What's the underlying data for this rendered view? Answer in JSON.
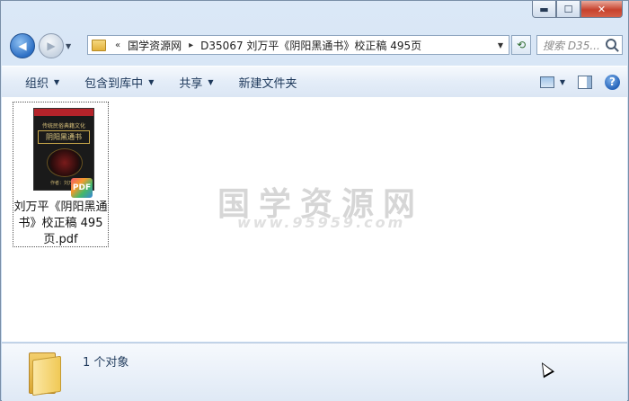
{
  "window": {
    "controls": {
      "minimize": "▬",
      "maximize": "☐",
      "close": "✕"
    }
  },
  "nav": {
    "back_glyph": "◀",
    "forward_glyph": "▶",
    "address": {
      "chevrons": "«",
      "segments": [
        "国学资源网",
        "D35067 刘万平《阴阳黑通书》校正稿 495页"
      ],
      "separator": "▸"
    },
    "refresh_glyph": "⟲",
    "search_placeholder": "搜索 D35..."
  },
  "toolbar": {
    "organize": "组织",
    "include_in_library": "包含到库中",
    "share": "共享",
    "new_folder": "新建文件夹"
  },
  "files": [
    {
      "name": "刘万平《阴阳黑通书》校正稿 495页.pdf",
      "name_lines": [
        "刘万平《阴阳黑通",
        "书》校正稿 495",
        "页.pdf"
      ],
      "badge": "PDF",
      "thumbnail": {
        "header_text": "传统民俗典籍文化",
        "title": "阴阳黑通书",
        "author": "作者：刘万平"
      }
    }
  ],
  "watermark": {
    "text": "国学资源网",
    "url": "www.95959.com"
  },
  "details": {
    "count_text": "1 个对象"
  }
}
